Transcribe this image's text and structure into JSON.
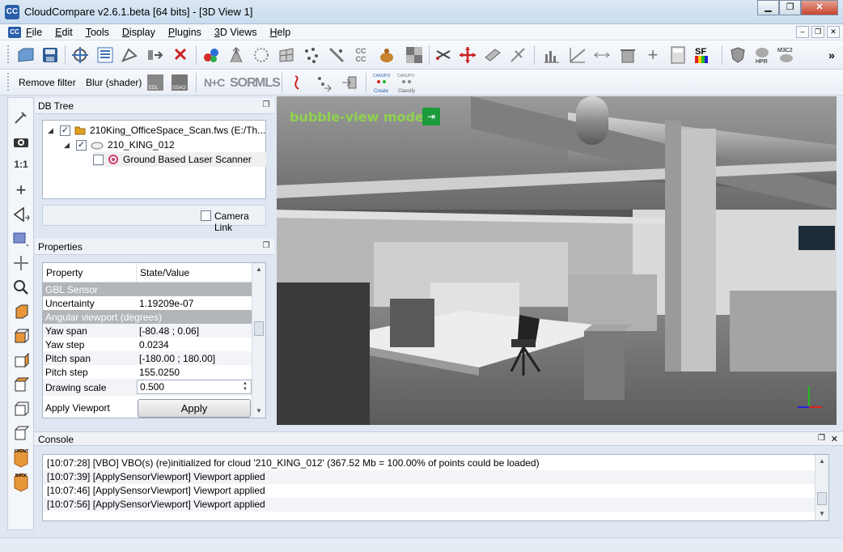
{
  "window": {
    "title": "CloudCompare v2.6.1.beta [64 bits] - [3D View 1]",
    "app_icon": "CC",
    "minimize": "▁",
    "restore": "❐",
    "close": "✕"
  },
  "menubar": {
    "items": [
      "File",
      "Edit",
      "Tools",
      "Display",
      "Plugins",
      "3D Views",
      "Help"
    ],
    "mdi_minimize": "–",
    "mdi_restore": "❐",
    "mdi_close": "✕"
  },
  "toolbar2": {
    "remove_filter": "Remove filter",
    "blur_shader": "Blur (shader)",
    "edl": "EDL",
    "ssao": "SSAO",
    "nc": "N+C",
    "sor": "SOR",
    "mls": "MLS",
    "canupo_create": "Create",
    "canupo_classify": "Classify",
    "canupo_label": "CANUPO"
  },
  "toolbar1_labels": {
    "sf": "SF",
    "hpr": "HPR",
    "m3c2": "M3C2",
    "more": "»",
    "cccc": "CC CC"
  },
  "left_toolbar": {
    "one_to_one": "1:1",
    "front": "FRONT",
    "back": "BACK"
  },
  "dbtree": {
    "title": "DB Tree",
    "items": [
      {
        "label": "210King_OfficeSpace_Scan.fws (E:/Th...",
        "checked": true
      },
      {
        "label": "210_KING_012",
        "checked": true
      },
      {
        "label": "Ground Based Laser Scanner",
        "checked": false
      }
    ],
    "camera_link": "Camera Link"
  },
  "properties": {
    "title": "Properties",
    "headers": [
      "Property",
      "State/Value"
    ],
    "sections": {
      "gbl_sensor": "GBL Sensor",
      "angular": "Angular viewport (degrees)"
    },
    "rows": {
      "uncertainty": {
        "key": "Uncertainty",
        "value": "1.19209e-07"
      },
      "yaw_span": {
        "key": "Yaw span",
        "value": "[-80.48 ; 0.06]"
      },
      "yaw_step": {
        "key": "Yaw step",
        "value": "0.0234"
      },
      "pitch_span": {
        "key": "Pitch span",
        "value": "[-180.00 ; 180.00]"
      },
      "pitch_step": {
        "key": "Pitch step",
        "value": "155.0250"
      },
      "drawing_scale": {
        "key": "Drawing scale",
        "value": "0.500"
      },
      "apply_viewport": {
        "key": "Apply Viewport",
        "button": "Apply"
      }
    }
  },
  "view3d": {
    "mode_label": "bubble-view mode",
    "exit_glyph": "⇥"
  },
  "console": {
    "title": "Console",
    "lines": [
      "[10:07:28] [VBO] VBO(s) (re)initialized for cloud '210_KING_012' (367.52 Mb = 100.00% of points could be loaded)",
      "[10:07:39] [ApplySensorViewport] Viewport applied",
      "[10:07:46] [ApplySensorViewport] Viewport applied",
      "[10:07:56] [ApplySensorViewport] Viewport applied"
    ]
  }
}
